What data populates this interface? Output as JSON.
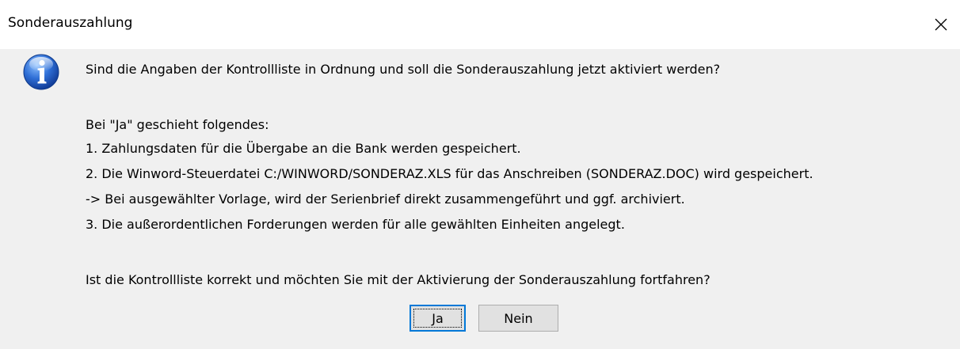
{
  "dialog": {
    "title": "Sonderauszahlung",
    "icon": "info-icon",
    "messages": {
      "question": "Sind die Angaben der Kontrollliste in Ordnung und soll die Sonderauszahlung jetzt aktiviert werden?",
      "intro": "Bei \"Ja\" geschieht folgendes:",
      "step1": "1. Zahlungsdaten für die Übergabe an die Bank werden gespeichert.",
      "step2": "2. Die Winword-Steuerdatei C:/WINWORD/SONDERAZ.XLS für das Anschreiben (SONDERAZ.DOC) wird gespeichert.",
      "note": "-> Bei ausgewählter Vorlage, wird der Serienbrief direkt zusammengeführt und ggf. archiviert.",
      "step3": "3. Die außerordentlichen Forderungen werden für alle gewählten Einheiten angelegt.",
      "confirm": "Ist die Kontrollliste korrekt und möchten Sie mit der Aktivierung der Sonderauszahlung fortfahren?"
    },
    "buttons": {
      "yes": "Ja",
      "no": "Nein"
    },
    "colors": {
      "accent": "#0078d7",
      "background": "#f0f0f0",
      "titlebar": "#ffffff"
    }
  }
}
